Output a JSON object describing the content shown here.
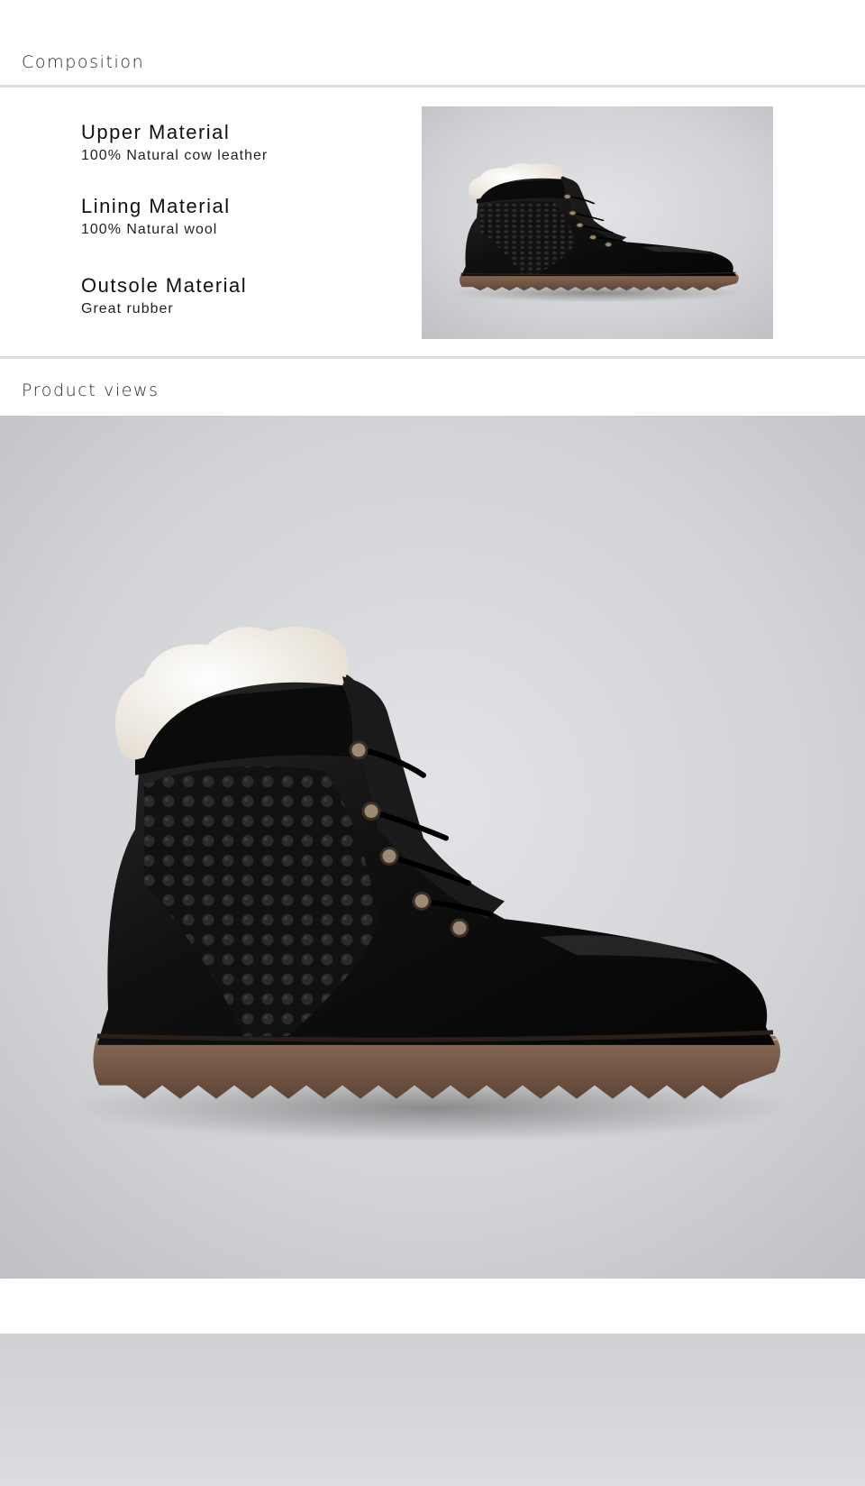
{
  "composition": {
    "title": "Composition",
    "materials": [
      {
        "name": "Upper Material",
        "value": "100% Natural cow leather"
      },
      {
        "name": "Lining Material",
        "value": "100% Natural wool"
      },
      {
        "name": "Outsole Material",
        "value": "Great rubber"
      }
    ]
  },
  "product_views": {
    "title": "Product views"
  },
  "colors": {
    "divider": "#dcdcdc",
    "photo_background": "#cfd0d3",
    "leather": "#121212",
    "outsole": "#7a5c4a",
    "fur": "#f3eee5"
  },
  "images": [
    {
      "name": "composition-boot-photo",
      "subject": "black leather lace-up boot with wool collar, side view"
    },
    {
      "name": "product-view-photo-1",
      "subject": "black leather lace-up boot with wool collar, side view"
    },
    {
      "name": "product-view-photo-2",
      "subject": "grey studio backdrop"
    }
  ]
}
